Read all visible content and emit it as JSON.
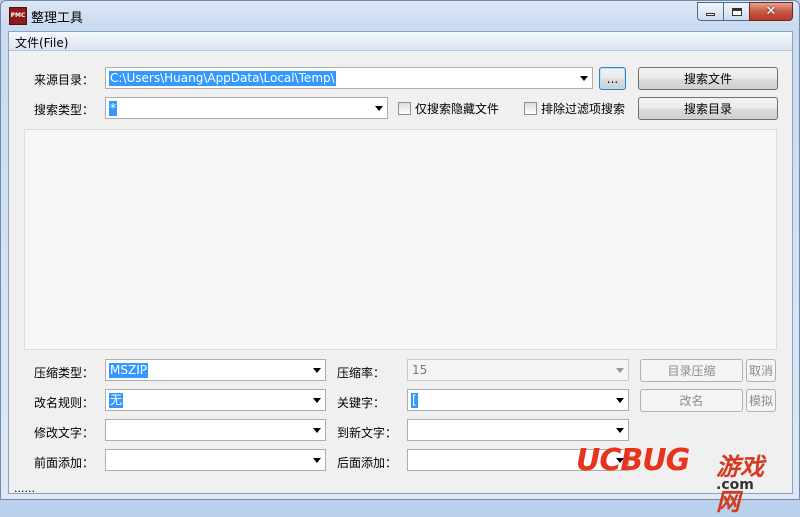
{
  "window": {
    "title": "整理工具",
    "icon_text": "PMC"
  },
  "menu": {
    "file": "文件(File)"
  },
  "source": {
    "label": "来源目录：",
    "path": "C:\\Users\\Huang\\AppData\\Local\\Temp\\",
    "browse": "...",
    "search_files": "搜索文件"
  },
  "search": {
    "label": "搜索类型：",
    "value": "*",
    "hidden_only": "仅搜索隐藏文件",
    "exclude_filtered": "排除过滤项搜索",
    "search_dirs": "搜索目录"
  },
  "compress": {
    "type_label": "压缩类型：",
    "type_value": "MSZIP",
    "rate_label": "压缩率：",
    "rate_value": "15",
    "dir_compress": "目录压缩",
    "cancel": "取消"
  },
  "rename": {
    "rule_label": "改名规则：",
    "rule_value": "无",
    "keyword_label": "关键字：",
    "keyword_value": "[",
    "rename_btn": "改名",
    "simulate": "模拟"
  },
  "modify": {
    "label": "修改文字：",
    "to_label": "到新文字："
  },
  "add": {
    "prefix_label": "前面添加：",
    "suffix_label": "后面添加："
  },
  "status": "......",
  "watermark": {
    "brand": "UCBUG",
    "cn": "游戏网",
    "domain": ".com"
  }
}
